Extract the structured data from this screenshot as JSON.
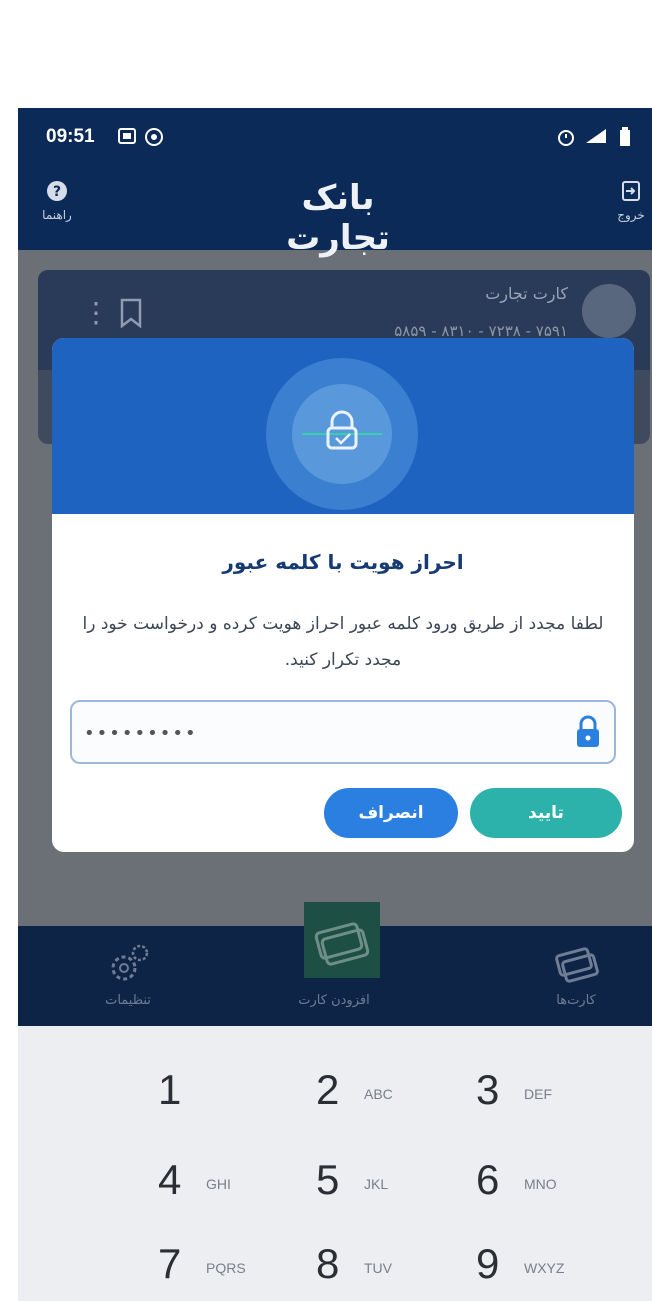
{
  "status_bar": {
    "time": "09:51",
    "icons_left": [
      "gallery-icon",
      "whatsapp-icon"
    ],
    "icons_right": [
      "alarm-icon",
      "signal-icon",
      "battery-icon"
    ]
  },
  "header": {
    "logo_text": "بانک تجارت",
    "help_label": "راهنما",
    "exit_label": "خروج"
  },
  "background_card": {
    "title": "کارت تجارت",
    "number": "۵۸۵۹ - ۸۳۱۰ - ۷۲۳۸ - ۷۵۹۱"
  },
  "dialog": {
    "title": "احراز هویت با کلمه عبور",
    "message": "لطفا مجدد از طریق ورود کلمه عبور احراز هویت کرده و درخواست خود را مجدد تکرار کنید.",
    "password_value": "•••••••••",
    "cancel_label": "انصراف",
    "confirm_label": "تایید"
  },
  "bottom_nav": {
    "settings_label": "تنظیمات",
    "add_card_label": "افزودن کارت",
    "cards_label": "کارت‌ها"
  },
  "keypad": {
    "keys": [
      {
        "digit": "1",
        "letters": ""
      },
      {
        "digit": "2",
        "letters": "ABC"
      },
      {
        "digit": "3",
        "letters": "DEF"
      },
      {
        "digit": "4",
        "letters": "GHI"
      },
      {
        "digit": "5",
        "letters": "JKL"
      },
      {
        "digit": "6",
        "letters": "MNO"
      },
      {
        "digit": "7",
        "letters": "PQRS"
      },
      {
        "digit": "8",
        "letters": "TUV"
      },
      {
        "digit": "9",
        "letters": "WXYZ"
      }
    ]
  },
  "colors": {
    "header_bg": "#0b2a57",
    "dialog_header_bg": "#1e63bf",
    "cancel_button": "#2a7fe0",
    "confirm_button": "#2cb2aa",
    "keypad_bg": "#eceef1"
  }
}
